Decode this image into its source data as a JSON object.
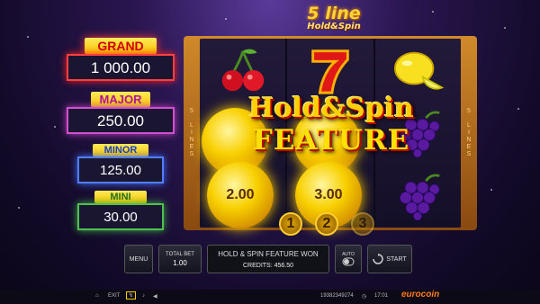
{
  "logo": {
    "line1": "5 line",
    "line2": "Hold&Spin"
  },
  "jackpots": {
    "grand": {
      "label": "GRAND",
      "value": "1 000.00"
    },
    "major": {
      "label": "MAJOR",
      "value": "250.00"
    },
    "minor": {
      "label": "MINOR",
      "value": "125.00"
    },
    "mini": {
      "label": "MINI",
      "value": "30.00"
    }
  },
  "side_label": "5 LINES",
  "reels": [
    [
      "cherry",
      "coin",
      "coin"
    ],
    [
      "seven",
      "coin",
      "coin"
    ],
    [
      "lemon",
      "grapes",
      "grapes"
    ]
  ],
  "coins": {
    "reel1_bottom": "2.00",
    "reel2_bottom": "3.00"
  },
  "feature": {
    "line1": "Hold&Spin",
    "line2": "FEATURE"
  },
  "bonus_counters": [
    "1",
    "2",
    "3"
  ],
  "controls": {
    "menu": "MENU",
    "total_bet_label": "TOTAL BET",
    "total_bet_value": "1.00",
    "message": "HOLD & SPIN FEATURE WON",
    "credits": "CREDITS: 456.50",
    "auto": "AUTO",
    "start": "START"
  },
  "statusbar": {
    "exit": "EXIT",
    "game_id": "19382349274",
    "time": "17:01",
    "brand": "eurocoin"
  }
}
